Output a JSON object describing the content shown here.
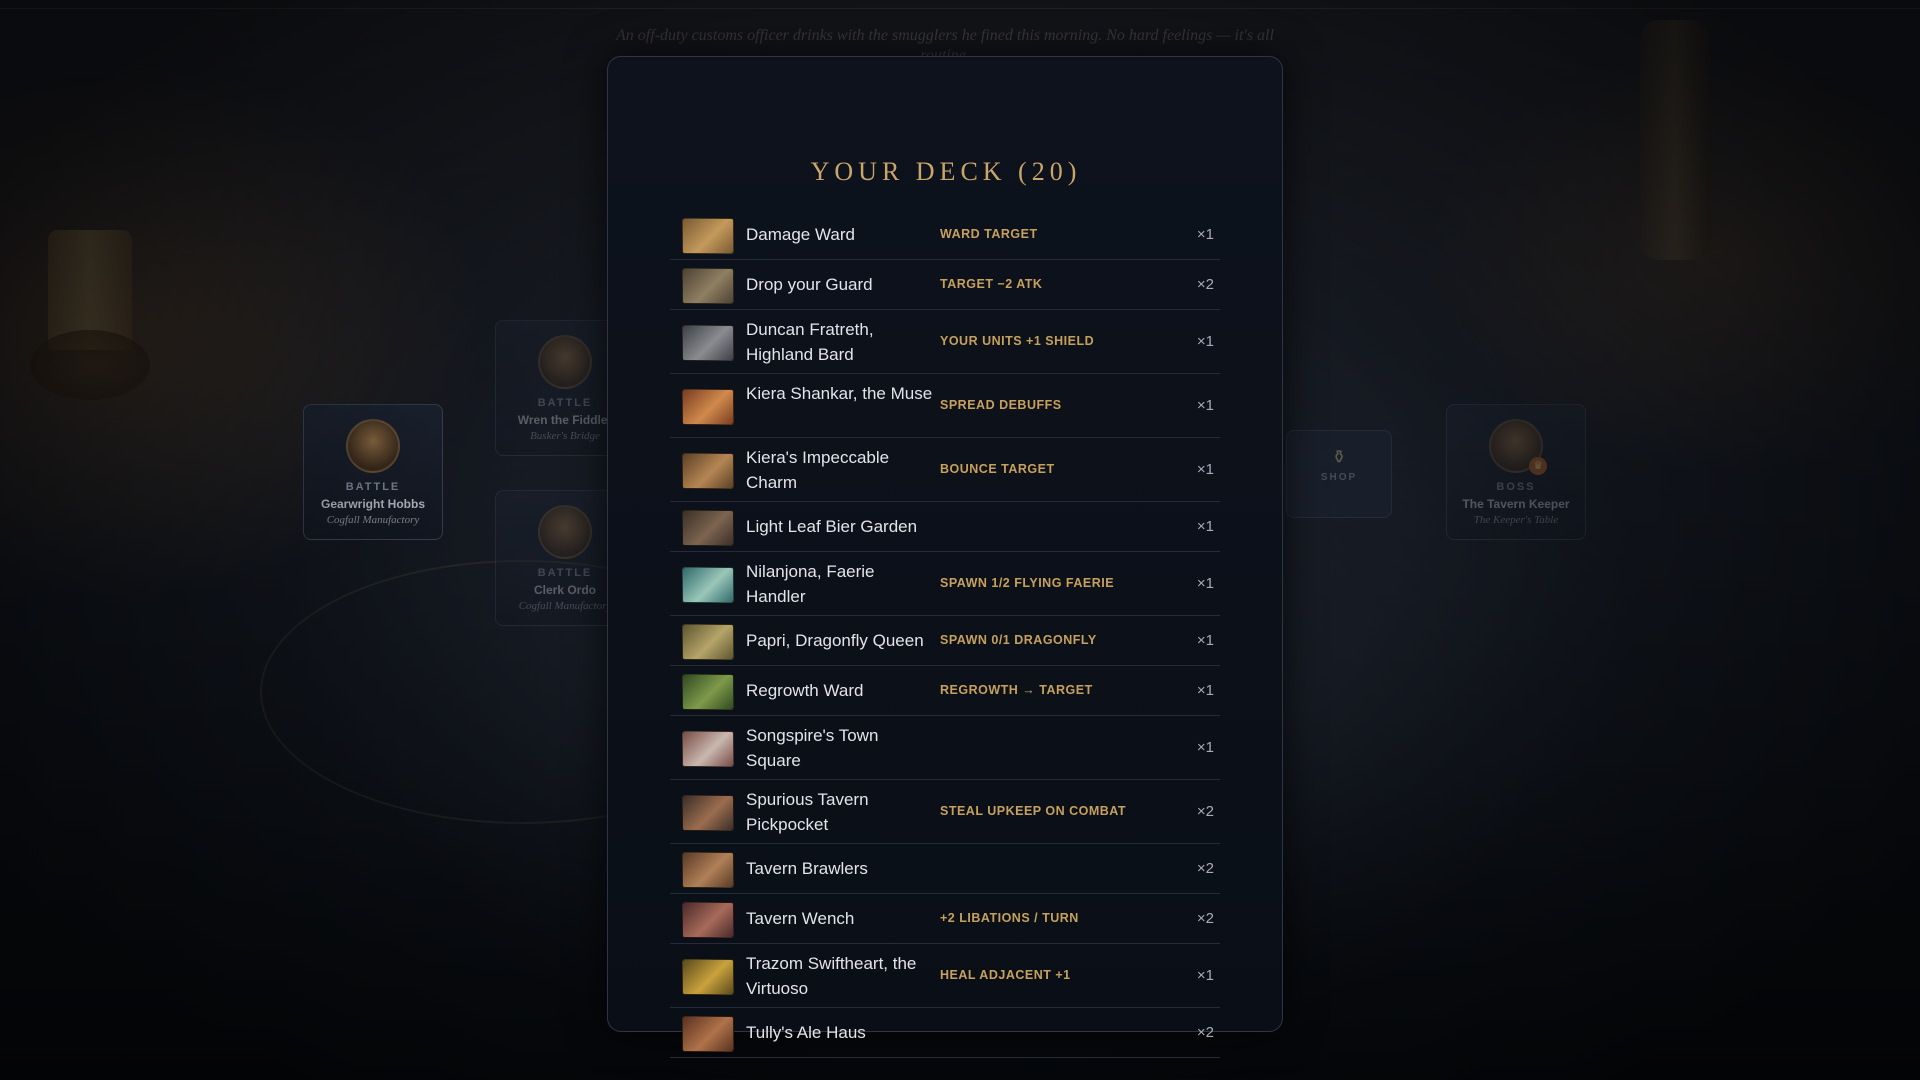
{
  "flavor_text": "An off-duty customs officer drinks with the smugglers he fined this morning. No hard feelings — it's all routine.",
  "map": {
    "nodes": [
      {
        "type": "BATTLE",
        "name": "Gearwright Hobbs",
        "location": "Cogfall Manufactory"
      },
      {
        "type": "BATTLE",
        "name": "Wren the Fiddler",
        "location": "Busker's Bridge"
      },
      {
        "type": "BATTLE",
        "name": "Clerk Ordo",
        "location": "Cogfall Manufactory"
      },
      {
        "type": "BOSS",
        "name": "The Tavern Keeper",
        "location": "The Keeper's Table"
      }
    ],
    "shop_label": "SHOP"
  },
  "deck": {
    "title": "YOUR DECK (20)",
    "cards": [
      {
        "name": "Damage Ward",
        "ability": "WARD TARGET",
        "count": "×1",
        "thumb": [
          "#7a5a34",
          "#c49a5c"
        ]
      },
      {
        "name": "Drop your Guard",
        "ability": "TARGET −2 ATK",
        "count": "×2",
        "thumb": [
          "#4d4334",
          "#8f7f62"
        ]
      },
      {
        "name": "Duncan Fratreth, Highland Bard",
        "ability": "YOUR UNITS +1 SHIELD",
        "count": "×1",
        "thumb": [
          "#3d4046",
          "#8a8c90"
        ]
      },
      {
        "name": "Kiera Shankar, the Muse",
        "ability": "SPREAD DEBUFFS",
        "count": "×1",
        "thumb": [
          "#7b3c22",
          "#d08a4c"
        ]
      },
      {
        "name": "Kiera's Impeccable Charm",
        "ability": "BOUNCE TARGET",
        "count": "×1",
        "thumb": [
          "#5c4125",
          "#b58654"
        ]
      },
      {
        "name": "Light Leaf Bier Garden",
        "ability": "",
        "count": "×1",
        "thumb": [
          "#3b3026",
          "#7c6450"
        ]
      },
      {
        "name": "Nilanjona, Faerie Handler",
        "ability": "SPAWN 1/2 FLYING FAERIE",
        "count": "×1",
        "thumb": [
          "#2f6a6c",
          "#9bc7b9"
        ]
      },
      {
        "name": "Papri, Dragonfly Queen",
        "ability": "SPAWN 0/1 DRAGONFLY",
        "count": "×1",
        "thumb": [
          "#5e5530",
          "#b6a56a"
        ]
      },
      {
        "name": "Regrowth Ward",
        "ability": "REGROWTH → TARGET",
        "count": "×1",
        "thumb": [
          "#2f4a22",
          "#7f9a4a"
        ]
      },
      {
        "name": "Songspire's Town Square",
        "ability": "",
        "count": "×1",
        "thumb": [
          "#7a4c44",
          "#c9b8b0"
        ]
      },
      {
        "name": "Spurious Tavern Pickpocket",
        "ability": "STEAL UPKEEP ON COMBAT",
        "count": "×2",
        "thumb": [
          "#3a2e2a",
          "#9c6d4e"
        ]
      },
      {
        "name": "Tavern Brawlers",
        "ability": "",
        "count": "×2",
        "thumb": [
          "#5a3a26",
          "#b08058"
        ]
      },
      {
        "name": "Tavern Wench",
        "ability": "+2 LIBATIONS / TURN",
        "count": "×2",
        "thumb": [
          "#4a2a2a",
          "#a86a5a"
        ]
      },
      {
        "name": "Trazom Swiftheart, the Virtuoso",
        "ability": "HEAL ADJACENT +1",
        "count": "×1",
        "thumb": [
          "#5a4a1c",
          "#c9a23c"
        ]
      },
      {
        "name": "Tully's Ale Haus",
        "ability": "",
        "count": "×2",
        "thumb": [
          "#5a3220",
          "#b0724a"
        ]
      }
    ]
  }
}
